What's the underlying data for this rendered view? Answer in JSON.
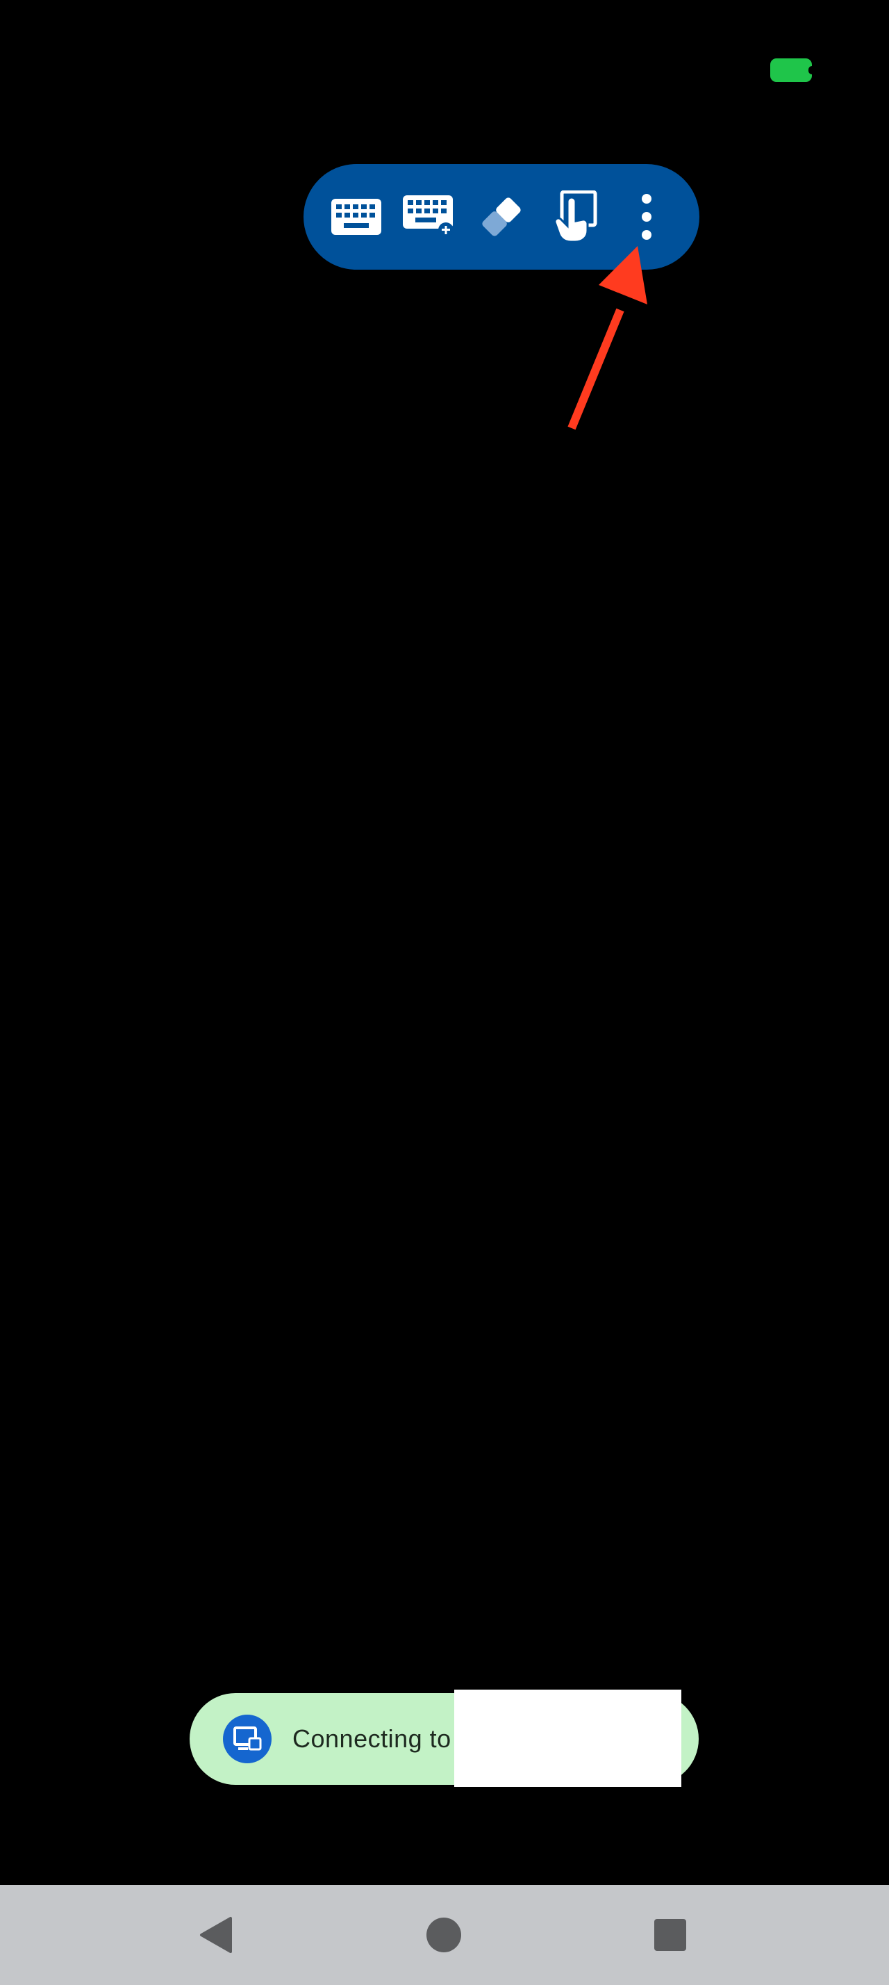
{
  "status_bar": {
    "battery_color": "#1fc54a"
  },
  "toolbar": {
    "background_color": "#00519a",
    "tools": [
      {
        "name": "keyboard-icon"
      },
      {
        "name": "keyboard-add-icon"
      },
      {
        "name": "eraser-icon"
      },
      {
        "name": "touch-mode-icon"
      },
      {
        "name": "more-options-icon"
      }
    ]
  },
  "annotation": {
    "arrow_color": "#ff3b1f",
    "points_to": "more-options-icon"
  },
  "toast": {
    "icon": "remote-desktop-icon",
    "message": "Connecting to",
    "background_color": "#c3f2c6"
  },
  "navigation_bar": {
    "background_color": "#c5c7ca",
    "buttons": [
      {
        "name": "back-triangle-icon"
      },
      {
        "name": "home-circle-icon"
      },
      {
        "name": "recents-square-icon"
      }
    ]
  }
}
